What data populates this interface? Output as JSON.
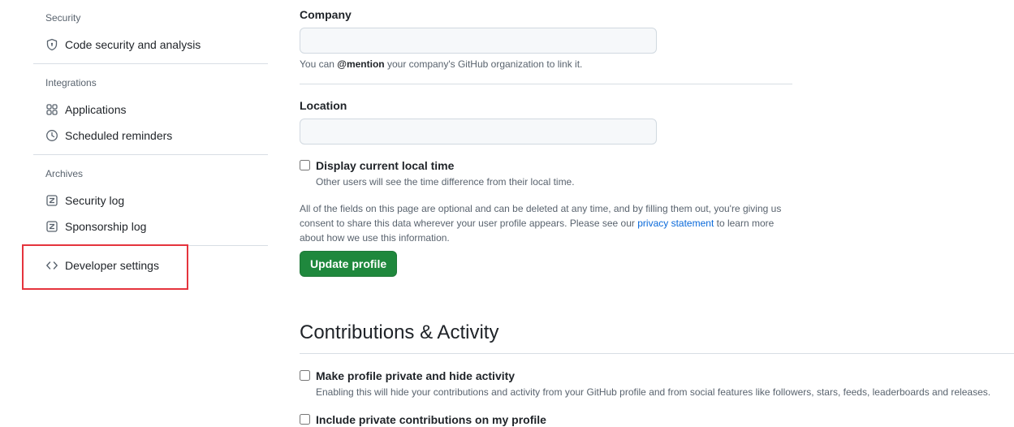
{
  "sidebar": {
    "groups": [
      {
        "heading": "Security",
        "items": [
          {
            "label": "Code security and analysis",
            "icon": "shield-lock-icon"
          }
        ]
      },
      {
        "heading": "Integrations",
        "items": [
          {
            "label": "Applications",
            "icon": "apps-icon"
          },
          {
            "label": "Scheduled reminders",
            "icon": "clock-icon"
          }
        ]
      },
      {
        "heading": "Archives",
        "items": [
          {
            "label": "Security log",
            "icon": "log-icon"
          },
          {
            "label": "Sponsorship log",
            "icon": "log-icon"
          }
        ]
      }
    ],
    "developer_settings": {
      "label": "Developer settings",
      "icon": "code-icon"
    },
    "highlight_color": "#e5343d"
  },
  "profile": {
    "company": {
      "label": "Company",
      "value": "",
      "note_prefix": "You can ",
      "note_mention": "@mention",
      "note_suffix": " your company's GitHub organization to link it."
    },
    "location": {
      "label": "Location",
      "value": ""
    },
    "local_time": {
      "label": "Display current local time",
      "note": "Other users will see the time difference from their local time.",
      "checked": false
    },
    "disclaimer": {
      "text_before": "All of the fields on this page are optional and can be deleted at any time, and by filling them out, you're giving us consent to share this data wherever your user profile appears. Please see our ",
      "link_text": "privacy statement",
      "text_after": " to learn more about how we use this information."
    },
    "update_button": "Update profile"
  },
  "contributions": {
    "title": "Contributions & Activity",
    "private": {
      "label": "Make profile private and hide activity",
      "note": "Enabling this will hide your contributions and activity from your GitHub profile and from social features like followers, stars, feeds, leaderboards and releases.",
      "checked": false
    },
    "include_private": {
      "label": "Include private contributions on my profile",
      "checked": false
    }
  },
  "colors": {
    "primary_button": "#1f883d",
    "link": "#0969da"
  }
}
